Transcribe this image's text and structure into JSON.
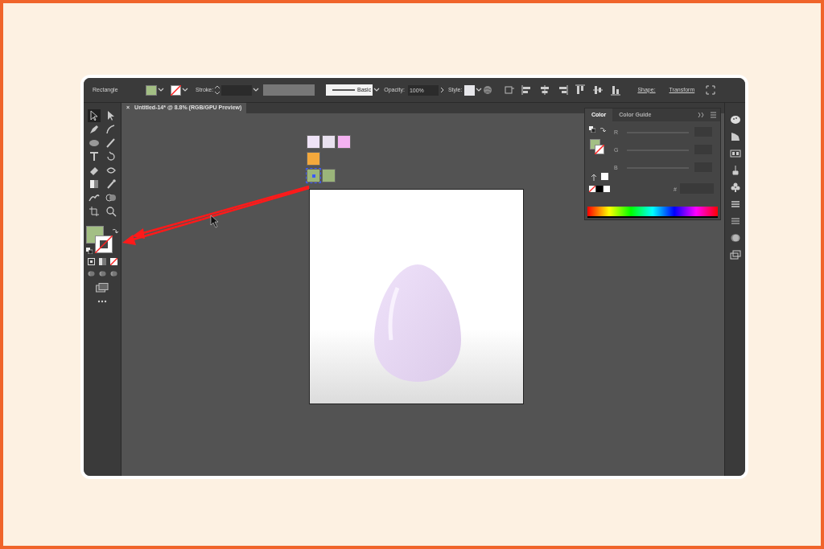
{
  "control_bar": {
    "selection_label": "Rectangle",
    "fill": {
      "color": "#a3bf84"
    },
    "stroke": {
      "none": true
    },
    "stroke_label": "Stroke:",
    "brush_label": "Basic",
    "opacity_label": "Opacity:",
    "opacity_value": "100%",
    "style_label": "Style:",
    "shape_label": "Shape:",
    "transform_label": "Transform"
  },
  "document_tab": {
    "close": "×",
    "title": "Untitled-14* @ 8.8% (RGB/GPU Preview)"
  },
  "toolbar": {
    "fill": {
      "color": "#a3bf84"
    },
    "stroke": {
      "none": true
    }
  },
  "canvas_swatches": [
    {
      "color": "#efe3f7",
      "selected": false
    },
    {
      "color": "#e9e1ef",
      "selected": false
    },
    {
      "color": "#f4b2f1",
      "selected": false
    },
    {
      "color": "#f3a83c",
      "selected": false
    },
    {
      "color": "#9bb57a",
      "selected": true
    },
    {
      "color": "#9bb57a",
      "selected": false
    }
  ],
  "color_panel": {
    "tabs": [
      {
        "label": "Color",
        "selected": true
      },
      {
        "label": "Color Guide",
        "selected": false
      }
    ],
    "fill": {
      "color": "#a3bf84"
    },
    "stroke": {
      "none": true
    },
    "channels": [
      {
        "label": "R"
      },
      {
        "label": "G"
      },
      {
        "label": "B"
      }
    ],
    "hex_label": "#"
  }
}
